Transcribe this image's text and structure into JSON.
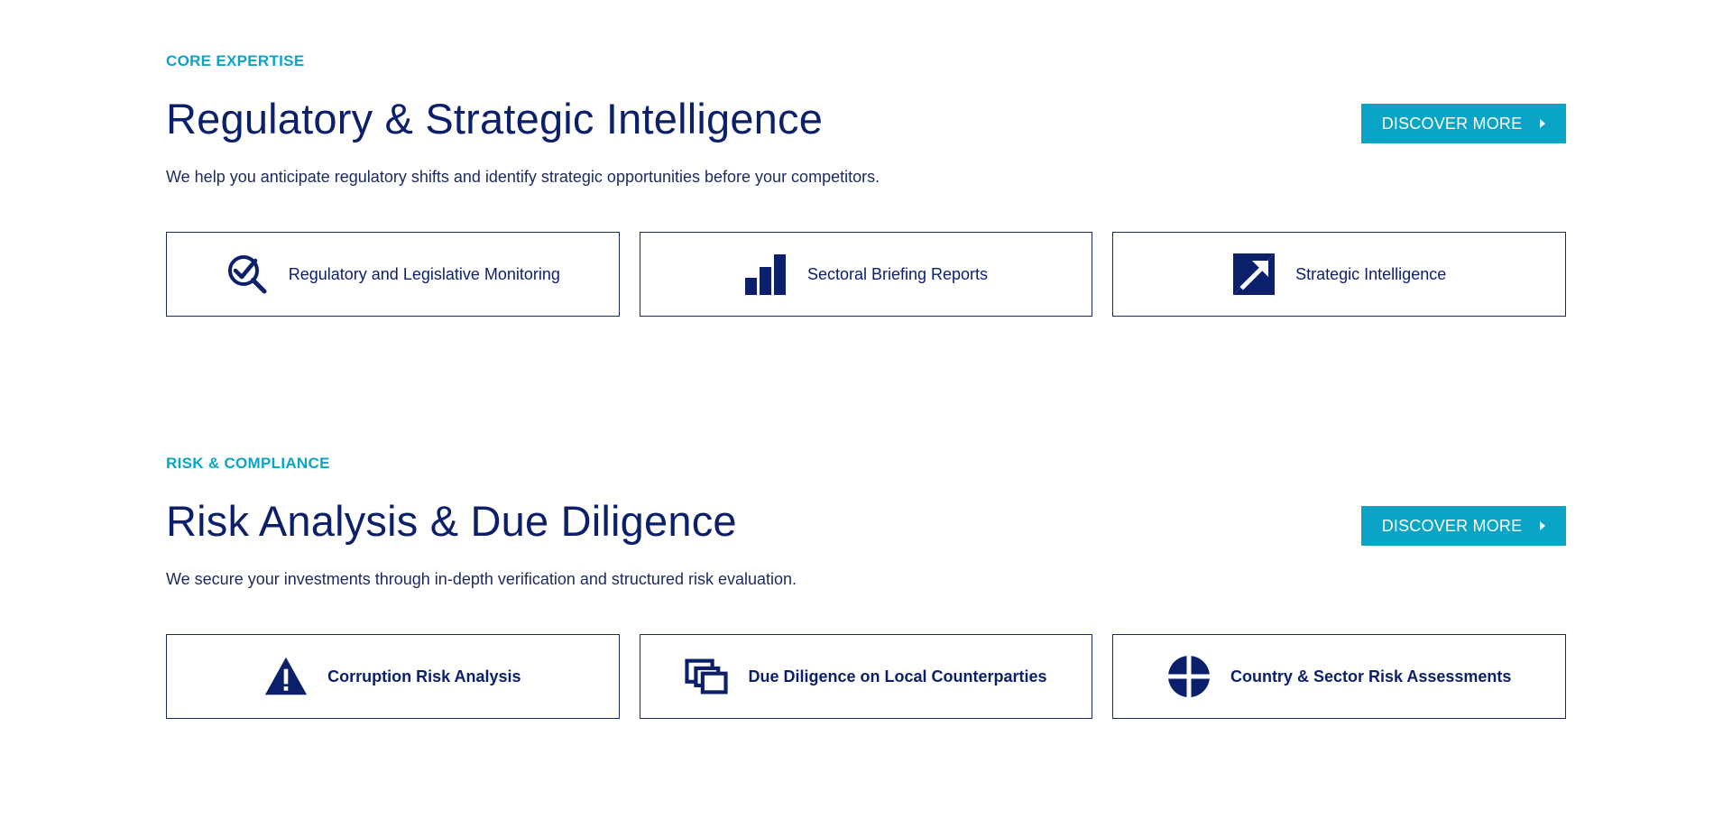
{
  "sections": [
    {
      "eyebrow": "CORE EXPERTISE",
      "title": "Regulatory & Strategic Intelligence",
      "description": "We help you anticipate regulatory shifts and identify strategic opportunities before your competitors.",
      "cta_label": "DISCOVER MORE",
      "cards": [
        {
          "label": "Regulatory and Legislative Monitoring",
          "icon": "magnifier-check-icon"
        },
        {
          "label": "Sectoral Briefing Reports",
          "icon": "bar-chart-icon"
        },
        {
          "label": "Strategic Intelligence",
          "icon": "arrow-up-right-icon"
        }
      ]
    },
    {
      "eyebrow": "RISK & COMPLIANCE",
      "title": "Risk Analysis & Due Diligence",
      "description": "We secure your investments through in-depth verification and structured risk evaluation.",
      "cta_label": "DISCOVER MORE",
      "cards": [
        {
          "label": "Corruption Risk Analysis",
          "icon": "warning-triangle-icon"
        },
        {
          "label": "Due Diligence on Local Counterparties",
          "icon": "overlapping-squares-icon"
        },
        {
          "label": "Country & Sector Risk Assessments",
          "icon": "globe-quadrants-icon"
        }
      ]
    }
  ],
  "colors": {
    "accent": "#0aa5c6",
    "navy": "#0b1f6a",
    "text": "#1b2a5e",
    "background": "#ffffff"
  }
}
